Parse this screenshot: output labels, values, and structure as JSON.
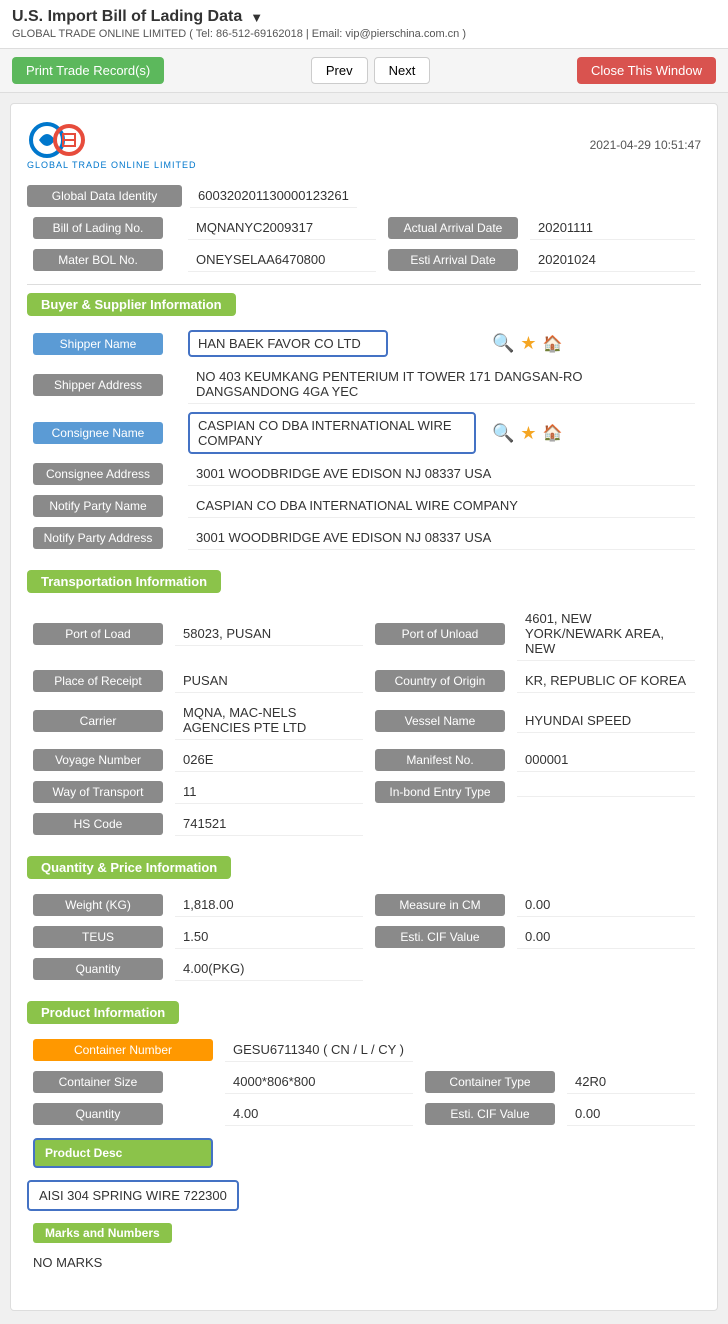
{
  "header": {
    "title": "U.S. Import Bill of Lading Data",
    "subtitle": "GLOBAL TRADE ONLINE LIMITED ( Tel: 86-512-69162018 | Email: vip@pierschina.com.cn )"
  },
  "toolbar": {
    "print_label": "Print Trade Record(s)",
    "prev_label": "Prev",
    "next_label": "Next",
    "close_label": "Close This Window"
  },
  "logo": {
    "text": "GTC",
    "subtext": "GLOBAL TRADE ONLINE LIMITED",
    "datetime": "2021-04-29 10:51:47"
  },
  "global_data_identity": "600320201130000123261",
  "bill_of_lading": {
    "label": "Bill of Lading No.",
    "value": "MQNANYC2009317",
    "actual_arrival_label": "Actual Arrival Date",
    "actual_arrival_value": "20201111"
  },
  "master_bol": {
    "label": "Mater BOL No.",
    "value": "ONEYSELAA6470800",
    "esti_arrival_label": "Esti Arrival Date",
    "esti_arrival_value": "20201024"
  },
  "buyer_supplier": {
    "section_title": "Buyer & Supplier Information",
    "shipper_name_label": "Shipper Name",
    "shipper_name_value": "HAN BAEK FAVOR CO LTD",
    "shipper_address_label": "Shipper Address",
    "shipper_address_value": "NO 403 KEUMKANG PENTERIUM IT TOWER 171 DANGSAN-RO DANGSANDONG 4GA YEC",
    "consignee_name_label": "Consignee Name",
    "consignee_name_value": "CASPIAN CO DBA INTERNATIONAL WIRE COMPANY",
    "consignee_address_label": "Consignee Address",
    "consignee_address_value": "3001 WOODBRIDGE AVE EDISON NJ 08337 USA",
    "notify_party_name_label": "Notify Party Name",
    "notify_party_name_value": "CASPIAN CO DBA INTERNATIONAL WIRE COMPANY",
    "notify_party_address_label": "Notify Party Address",
    "notify_party_address_value": "3001 WOODBRIDGE AVE EDISON NJ 08337 USA"
  },
  "transportation": {
    "section_title": "Transportation Information",
    "port_of_load_label": "Port of Load",
    "port_of_load_value": "58023, PUSAN",
    "port_of_unload_label": "Port of Unload",
    "port_of_unload_value": "4601, NEW YORK/NEWARK AREA, NEW",
    "place_of_receipt_label": "Place of Receipt",
    "place_of_receipt_value": "PUSAN",
    "country_of_origin_label": "Country of Origin",
    "country_of_origin_value": "KR, REPUBLIC OF KOREA",
    "carrier_label": "Carrier",
    "carrier_value": "MQNA, MAC-NELS AGENCIES PTE LTD",
    "vessel_name_label": "Vessel Name",
    "vessel_name_value": "HYUNDAI SPEED",
    "voyage_number_label": "Voyage Number",
    "voyage_number_value": "026E",
    "manifest_no_label": "Manifest No.",
    "manifest_no_value": "000001",
    "way_of_transport_label": "Way of Transport",
    "way_of_transport_value": "11",
    "in_bond_entry_label": "In-bond Entry Type",
    "in_bond_entry_value": "",
    "hs_code_label": "HS Code",
    "hs_code_value": "741521"
  },
  "quantity_price": {
    "section_title": "Quantity & Price Information",
    "weight_label": "Weight (KG)",
    "weight_value": "1,818.00",
    "measure_label": "Measure in CM",
    "measure_value": "0.00",
    "teus_label": "TEUS",
    "teus_value": "1.50",
    "esti_cif_label": "Esti. CIF Value",
    "esti_cif_value": "0.00",
    "quantity_label": "Quantity",
    "quantity_value": "4.00(PKG)"
  },
  "product_info": {
    "section_title": "Product Information",
    "container_number_label": "Container Number",
    "container_number_value": "GESU6711340 ( CN / L / CY )",
    "container_size_label": "Container Size",
    "container_size_value": "4000*806*800",
    "container_type_label": "Container Type",
    "container_type_value": "42R0",
    "quantity_label": "Quantity",
    "quantity_value": "4.00",
    "esti_cif_label": "Esti. CIF Value",
    "esti_cif_value": "0.00",
    "product_desc_label": "Product Desc",
    "product_desc_value": "AISI 304 SPRING WIRE 722300",
    "marks_label": "Marks and Numbers",
    "marks_value": "NO MARKS"
  }
}
